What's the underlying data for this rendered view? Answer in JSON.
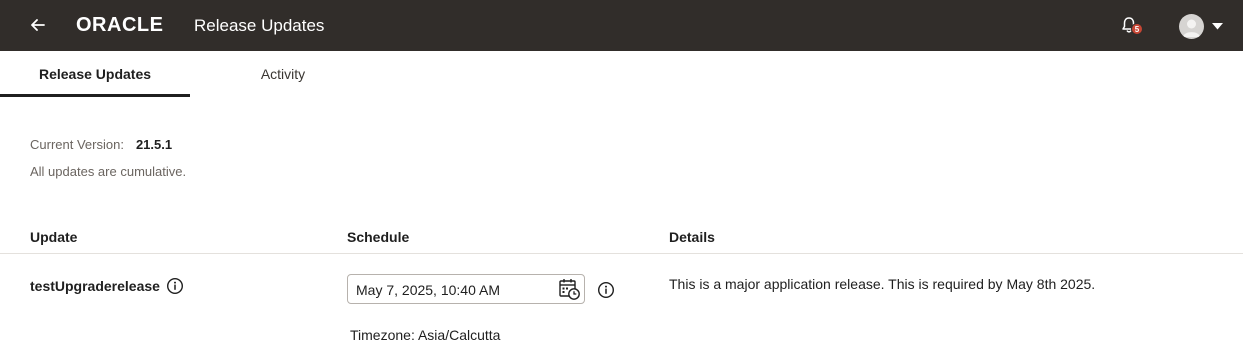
{
  "header": {
    "back_icon": "arrow-left-icon",
    "logo_text": "ORACLE",
    "title": "Release Updates",
    "notifications": {
      "icon": "bell-icon",
      "count": "5",
      "badge_color": "#c74634"
    },
    "user_menu": {
      "icon": "avatar-icon",
      "caret_icon": "caret-down-icon"
    }
  },
  "tabs": [
    {
      "label": "Release Updates",
      "active": true
    },
    {
      "label": "Activity",
      "active": false
    }
  ],
  "version": {
    "label": "Current Version:",
    "value": "21.5.1",
    "note": "All updates are cumulative."
  },
  "table": {
    "columns": [
      "Update",
      "Schedule",
      "Details"
    ],
    "rows": [
      {
        "update": "testUpgraderelease",
        "schedule": "May 7, 2025, 10:40 AM",
        "timezone": "Timezone: Asia/Calcutta",
        "details": "This is a major application release. This is required by May 8th 2025."
      }
    ]
  },
  "colors": {
    "header_bg": "#312d2a",
    "accent_badge": "#c74634",
    "divider": "#e4e1dd"
  }
}
